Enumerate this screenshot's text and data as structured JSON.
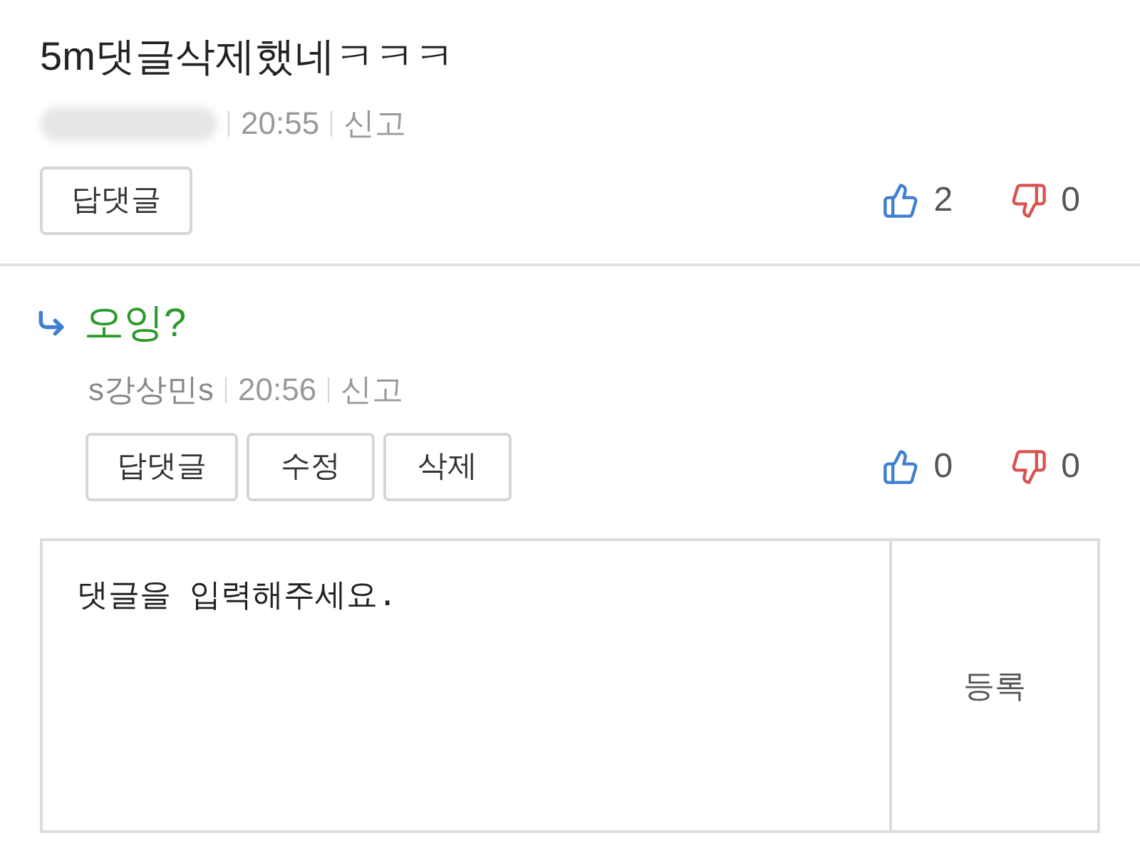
{
  "comments": [
    {
      "reply": false,
      "text": "5m댓글삭제했네ㅋㅋㅋ",
      "redacted": true,
      "time": "20:55",
      "report": "신고",
      "buttons": [
        "답댓글"
      ],
      "likes": "2",
      "dislikes": "0"
    },
    {
      "reply": true,
      "text": "오잉?",
      "redacted": false,
      "author": "s강상민s",
      "time": "20:56",
      "report": "신고",
      "buttons": [
        "답댓글",
        "수정",
        "삭제"
      ],
      "likes": "0",
      "dislikes": "0"
    }
  ],
  "reply_form": {
    "placeholder": "댓글을 입력해주세요.",
    "submit": "등록"
  }
}
